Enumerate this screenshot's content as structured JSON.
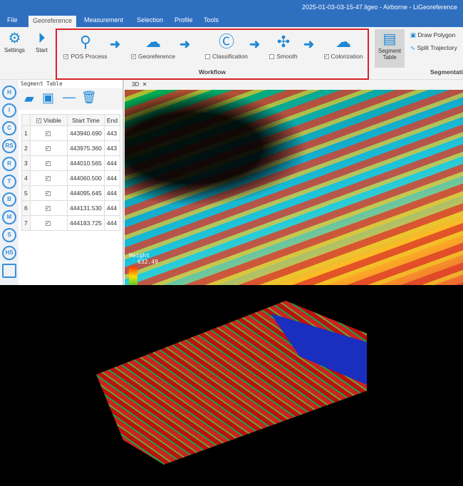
{
  "window_title": "2025-01-03-03-15-47.ligeo - Airborne - LiGeoreference",
  "tabs": [
    "File",
    "Georeference",
    "Measurement",
    "Selection",
    "Profile",
    "Tools"
  ],
  "ribbon": {
    "settings": "Settings",
    "start": "Start",
    "segment_table": "Segment Table",
    "draw_polygon": "Draw Polygon",
    "split_trajectory": "Split Trajectory",
    "segmentation_group": "Segmentation"
  },
  "workflow": {
    "label": "Workflow",
    "steps": [
      {
        "label": "POS Process",
        "checked": true
      },
      {
        "label": "Georeference",
        "checked": true
      },
      {
        "label": "Classification",
        "checked": false
      },
      {
        "label": "Smooth",
        "checked": false
      },
      {
        "label": "Colorization",
        "checked": true
      }
    ]
  },
  "side_icons": [
    "H",
    "I",
    "C",
    "RS",
    "R",
    "T",
    "B",
    "M",
    "S",
    "HS"
  ],
  "segment_table": {
    "title": "Segment Table",
    "columns": [
      "Visible",
      "Start Time",
      "End"
    ],
    "rows": [
      [
        "1",
        "443940.690",
        "443"
      ],
      [
        "2",
        "443975.360",
        "443"
      ],
      [
        "3",
        "444010.565",
        "444"
      ],
      [
        "4",
        "444060.500",
        "444"
      ],
      [
        "5",
        "444095.645",
        "444"
      ],
      [
        "6",
        "444131.530",
        "444"
      ],
      [
        "7",
        "444183.725",
        "444"
      ]
    ]
  },
  "view": {
    "tab": "3D",
    "legend_title": "Height",
    "legend_value": "632.49"
  },
  "check": "✓"
}
